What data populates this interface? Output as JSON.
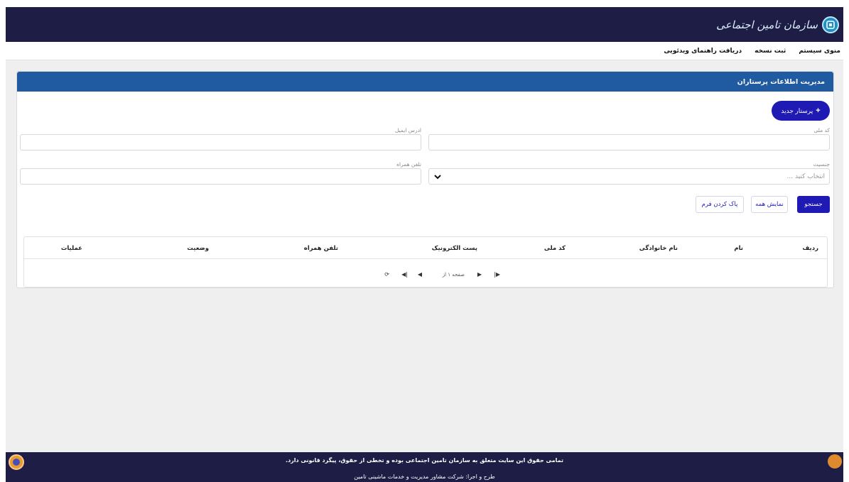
{
  "header": {
    "logo_text": "سازمان تامین اجتماعی"
  },
  "menu": {
    "items": [
      "منوی سیستم",
      "ثبت نسخه",
      "دریافت راهنمای ویدئویی"
    ]
  },
  "panel": {
    "title": "مدیریت اطلاعات پرستاران",
    "new_button": "پرستار جدید"
  },
  "form": {
    "national_code_label": "کد ملی",
    "email_label": "ادرس ایمیل",
    "gender_label": "جنسیت",
    "gender_placeholder": "انتخاب کنید ...",
    "mobile_label": "تلفن همراه"
  },
  "actions": {
    "search": "جستجو",
    "show_all": "نمایش همه",
    "clear_form": "پاک کردن فرم"
  },
  "table": {
    "columns": [
      "ردیف",
      "نام",
      "نام خانوادگی",
      "کد ملی",
      "پست الکترونیک",
      "تلفن همراه",
      "وضعیت",
      "عملیات"
    ]
  },
  "pager": {
    "text": "صفحه ۱ از"
  },
  "footer": {
    "line1": "تمامی حقوق این سایت متعلق به سازمان تامین اجتماعی بوده و تخطی از حقوق، پیگرد قانونی دارد.",
    "line2": "طرح و اجرا: شرکت مشاور مدیریت و خدمات ماشینی تامین"
  },
  "colors": {
    "topbar": "#1d1d45",
    "panel_header": "#205aa0",
    "primary": "#1f1ab3"
  }
}
